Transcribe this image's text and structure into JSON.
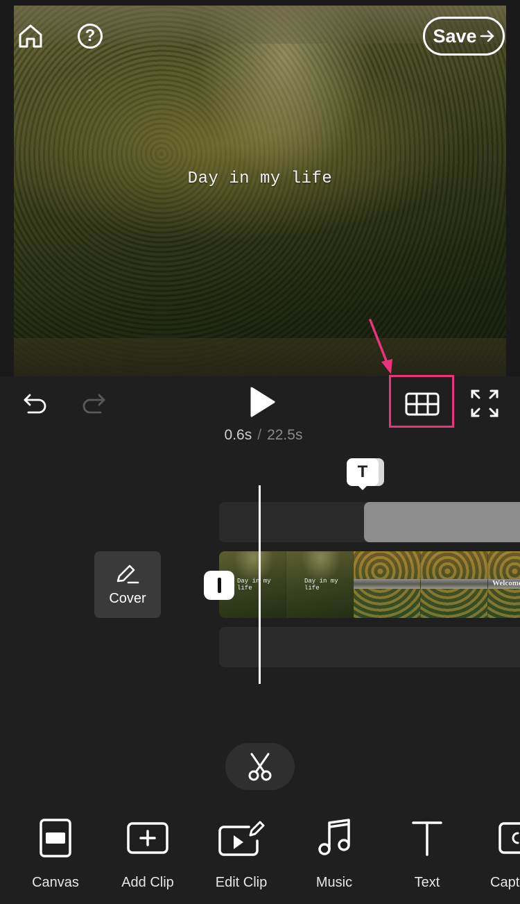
{
  "preview": {
    "overlay_text": "Day in my life",
    "save_label": "Save"
  },
  "playback": {
    "current_time": "0.6s",
    "separator": "/",
    "total_time": "22.5s"
  },
  "timeline": {
    "text_marker_label": "T",
    "cover_label": "Cover",
    "thumb_text_1": "Day in my life",
    "thumb_text_2": "Day in my life",
    "thumb_welcome": "Welcome"
  },
  "toolbar": {
    "items": [
      {
        "label": "Canvas",
        "icon": "canvas-icon"
      },
      {
        "label": "Add Clip",
        "icon": "add-clip-icon"
      },
      {
        "label": "Edit Clip",
        "icon": "edit-clip-icon"
      },
      {
        "label": "Music",
        "icon": "music-icon"
      },
      {
        "label": "Text",
        "icon": "text-icon"
      },
      {
        "label": "Capt",
        "icon": "captions-icon"
      }
    ]
  },
  "colors": {
    "background": "#1f1f1f",
    "highlight": "#e8347a",
    "text_clip": "#8d8d8d"
  }
}
